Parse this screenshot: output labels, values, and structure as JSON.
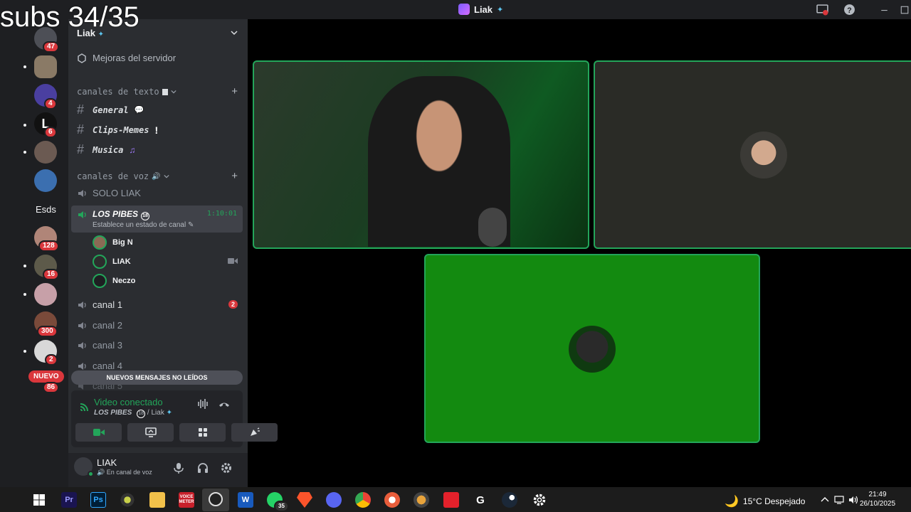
{
  "overlay": {
    "subs_text": "subs 34/35"
  },
  "titlebar": {
    "title": "Liak"
  },
  "rail": {
    "badges": [
      "47",
      "4",
      "6",
      "128",
      "16",
      "300",
      "2",
      "86"
    ],
    "folder_label": "Esds",
    "new_label": "NUEVO"
  },
  "server": {
    "name": "Liak",
    "boost_label": "Mejoras del servidor",
    "text_category": "canales de texto",
    "voice_category": "canales de voz",
    "text_channels": [
      "General",
      "Clips-Memes",
      "Musica"
    ],
    "voice_channels": {
      "solo": "SOLO LIAK",
      "active": {
        "name": "LOS PIBES",
        "age": "18",
        "status": "Establece un estado de canal",
        "elapsed": "1:10:01"
      },
      "members": [
        "Big N",
        "LIAK",
        "Neczo"
      ],
      "others": [
        "canal 1",
        "canal 2",
        "canal 3",
        "canal 4",
        "canal 5"
      ],
      "canal1_mentions": "2"
    },
    "new_messages_bar": "NUEVOS MENSAJES NO LEÍDOS"
  },
  "voice_panel": {
    "title": "Video conectado",
    "channel": "LOS PIBES",
    "server": "/ Liak"
  },
  "user_panel": {
    "name": "LIAK",
    "status": "En canal de voz"
  },
  "taskbar": {
    "whatsapp_badge": "35",
    "weather": "15°C  Despejado",
    "time": "21:49",
    "date": "26/10/2025",
    "ps_label": "Ps",
    "pr_label": "Pr",
    "voicemeeter_label": "VOICE METER"
  },
  "colors": {
    "green": "#23a55a",
    "red": "#da373c",
    "sidebar": "#2b2d31"
  }
}
